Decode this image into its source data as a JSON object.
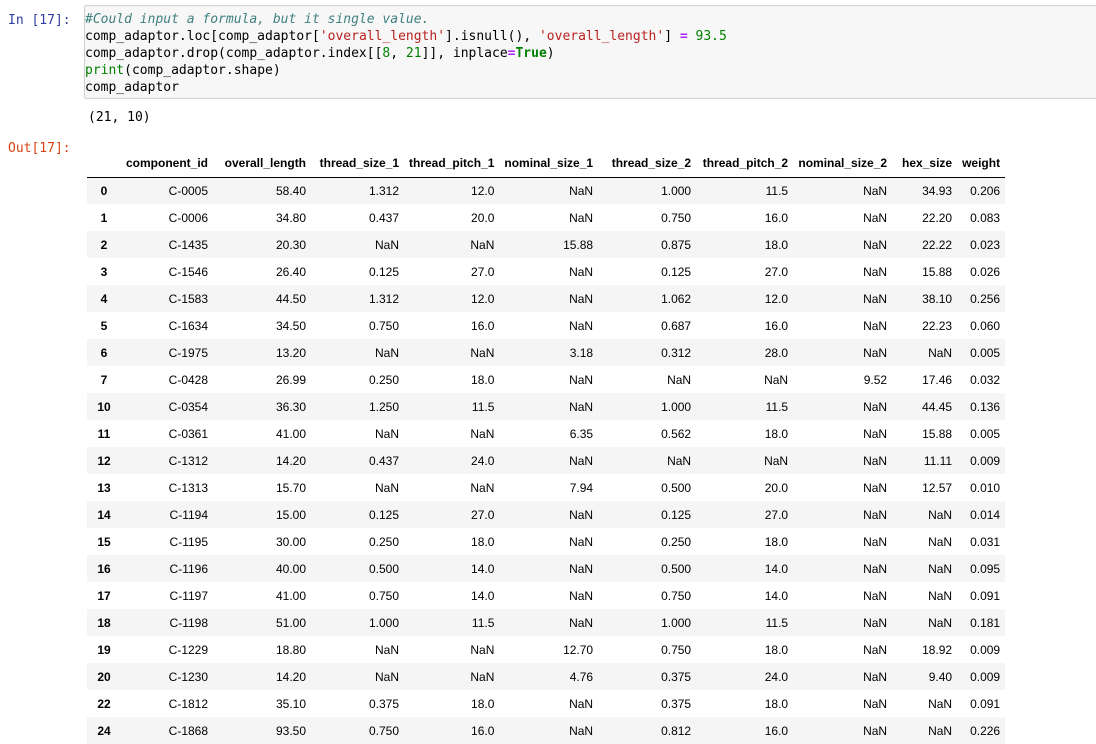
{
  "input": {
    "prompt": "In [17]:",
    "code": {
      "comment": "#Could input a formula, but it single value.",
      "line2": {
        "a": "comp_adaptor.loc[comp_adaptor[",
        "s1": "'overall_length'",
        "b": "].isnull(), ",
        "s2": "'overall_length'",
        "c": "] ",
        "op": "=",
        "d": " ",
        "num": "93.5"
      },
      "line3": {
        "a": "comp_adaptor.drop(comp_adaptor.index[[",
        "n1": "8",
        "b": ", ",
        "n2": "21",
        "c": "]], inplace",
        "op": "=",
        "kw": "True",
        "d": ")"
      },
      "line4": {
        "fn": "print",
        "rest": "(comp_adaptor.shape)"
      },
      "line5": "comp_adaptor"
    }
  },
  "stdout": "(21, 10)",
  "output": {
    "prompt": "Out[17]:",
    "columns": [
      "",
      "component_id",
      "overall_length",
      "thread_size_1",
      "thread_pitch_1",
      "nominal_size_1",
      "thread_size_2",
      "thread_pitch_2",
      "nominal_size_2",
      "hex_size",
      "weight"
    ],
    "rows": [
      [
        "0",
        "C-0005",
        "58.40",
        "1.312",
        "12.0",
        "NaN",
        "1.000",
        "11.5",
        "NaN",
        "34.93",
        "0.206"
      ],
      [
        "1",
        "C-0006",
        "34.80",
        "0.437",
        "20.0",
        "NaN",
        "0.750",
        "16.0",
        "NaN",
        "22.20",
        "0.083"
      ],
      [
        "2",
        "C-1435",
        "20.30",
        "NaN",
        "NaN",
        "15.88",
        "0.875",
        "18.0",
        "NaN",
        "22.22",
        "0.023"
      ],
      [
        "3",
        "C-1546",
        "26.40",
        "0.125",
        "27.0",
        "NaN",
        "0.125",
        "27.0",
        "NaN",
        "15.88",
        "0.026"
      ],
      [
        "4",
        "C-1583",
        "44.50",
        "1.312",
        "12.0",
        "NaN",
        "1.062",
        "12.0",
        "NaN",
        "38.10",
        "0.256"
      ],
      [
        "5",
        "C-1634",
        "34.50",
        "0.750",
        "16.0",
        "NaN",
        "0.687",
        "16.0",
        "NaN",
        "22.23",
        "0.060"
      ],
      [
        "6",
        "C-1975",
        "13.20",
        "NaN",
        "NaN",
        "3.18",
        "0.312",
        "28.0",
        "NaN",
        "NaN",
        "0.005"
      ],
      [
        "7",
        "C-0428",
        "26.99",
        "0.250",
        "18.0",
        "NaN",
        "NaN",
        "NaN",
        "9.52",
        "17.46",
        "0.032"
      ],
      [
        "10",
        "C-0354",
        "36.30",
        "1.250",
        "11.5",
        "NaN",
        "1.000",
        "11.5",
        "NaN",
        "44.45",
        "0.136"
      ],
      [
        "11",
        "C-0361",
        "41.00",
        "NaN",
        "NaN",
        "6.35",
        "0.562",
        "18.0",
        "NaN",
        "15.88",
        "0.005"
      ],
      [
        "12",
        "C-1312",
        "14.20",
        "0.437",
        "24.0",
        "NaN",
        "NaN",
        "NaN",
        "NaN",
        "11.11",
        "0.009"
      ],
      [
        "13",
        "C-1313",
        "15.70",
        "NaN",
        "NaN",
        "7.94",
        "0.500",
        "20.0",
        "NaN",
        "12.57",
        "0.010"
      ],
      [
        "14",
        "C-1194",
        "15.00",
        "0.125",
        "27.0",
        "NaN",
        "0.125",
        "27.0",
        "NaN",
        "NaN",
        "0.014"
      ],
      [
        "15",
        "C-1195",
        "30.00",
        "0.250",
        "18.0",
        "NaN",
        "0.250",
        "18.0",
        "NaN",
        "NaN",
        "0.031"
      ],
      [
        "16",
        "C-1196",
        "40.00",
        "0.500",
        "14.0",
        "NaN",
        "0.500",
        "14.0",
        "NaN",
        "NaN",
        "0.095"
      ],
      [
        "17",
        "C-1197",
        "41.00",
        "0.750",
        "14.0",
        "NaN",
        "0.750",
        "14.0",
        "NaN",
        "NaN",
        "0.091"
      ],
      [
        "18",
        "C-1198",
        "51.00",
        "1.000",
        "11.5",
        "NaN",
        "1.000",
        "11.5",
        "NaN",
        "NaN",
        "0.181"
      ],
      [
        "19",
        "C-1229",
        "18.80",
        "NaN",
        "NaN",
        "12.70",
        "0.750",
        "18.0",
        "NaN",
        "18.92",
        "0.009"
      ],
      [
        "20",
        "C-1230",
        "14.20",
        "NaN",
        "NaN",
        "4.76",
        "0.375",
        "24.0",
        "NaN",
        "9.40",
        "0.009"
      ],
      [
        "22",
        "C-1812",
        "35.10",
        "0.375",
        "18.0",
        "NaN",
        "0.375",
        "18.0",
        "NaN",
        "NaN",
        "0.091"
      ],
      [
        "24",
        "C-1868",
        "93.50",
        "0.750",
        "16.0",
        "NaN",
        "0.812",
        "16.0",
        "NaN",
        "NaN",
        "0.226"
      ]
    ]
  }
}
